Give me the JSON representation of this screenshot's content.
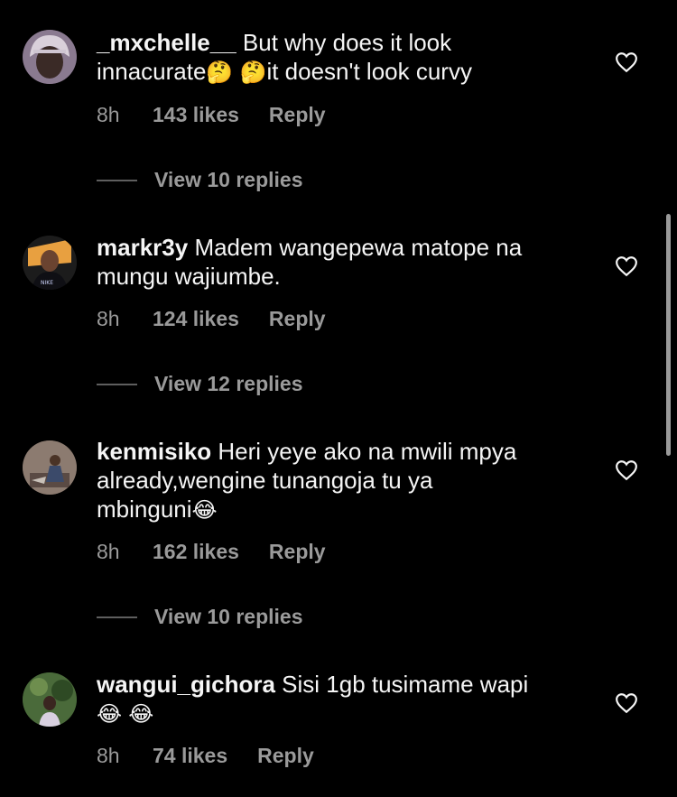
{
  "comments": [
    {
      "username": "_mxchelle__",
      "text_parts": [
        "But why does it look",
        "innacurate",
        "🤔",
        " ",
        "🤔",
        "it doesn't look curvy"
      ],
      "time": "8h",
      "likes": "143 likes",
      "reply": "Reply",
      "view_replies": "View 10 replies"
    },
    {
      "username": "markr3y",
      "text_parts": [
        "Madem wangepewa matope na",
        "mungu wajiumbe."
      ],
      "time": "8h",
      "likes": "124 likes",
      "reply": "Reply",
      "view_replies": "View 12 replies"
    },
    {
      "username": "kenmisiko",
      "text_parts": [
        "Heri yeye ako na mwili mpya",
        "already,wengine tunangoja tu ya",
        "mbinguni",
        "😂"
      ],
      "time": "8h",
      "likes": "162 likes",
      "reply": "Reply",
      "view_replies": "View 10 replies"
    },
    {
      "username": "wangui_gichora",
      "text_parts": [
        "Sisi 1gb tusimame wapi",
        "😂",
        "😂"
      ],
      "time": "8h",
      "likes": "74 likes",
      "reply": "Reply"
    }
  ],
  "icons": {
    "like": "heart-outline-icon"
  },
  "colors": {
    "background": "#000000",
    "text": "#f5f5f5",
    "secondary": "#9a9a9a"
  }
}
